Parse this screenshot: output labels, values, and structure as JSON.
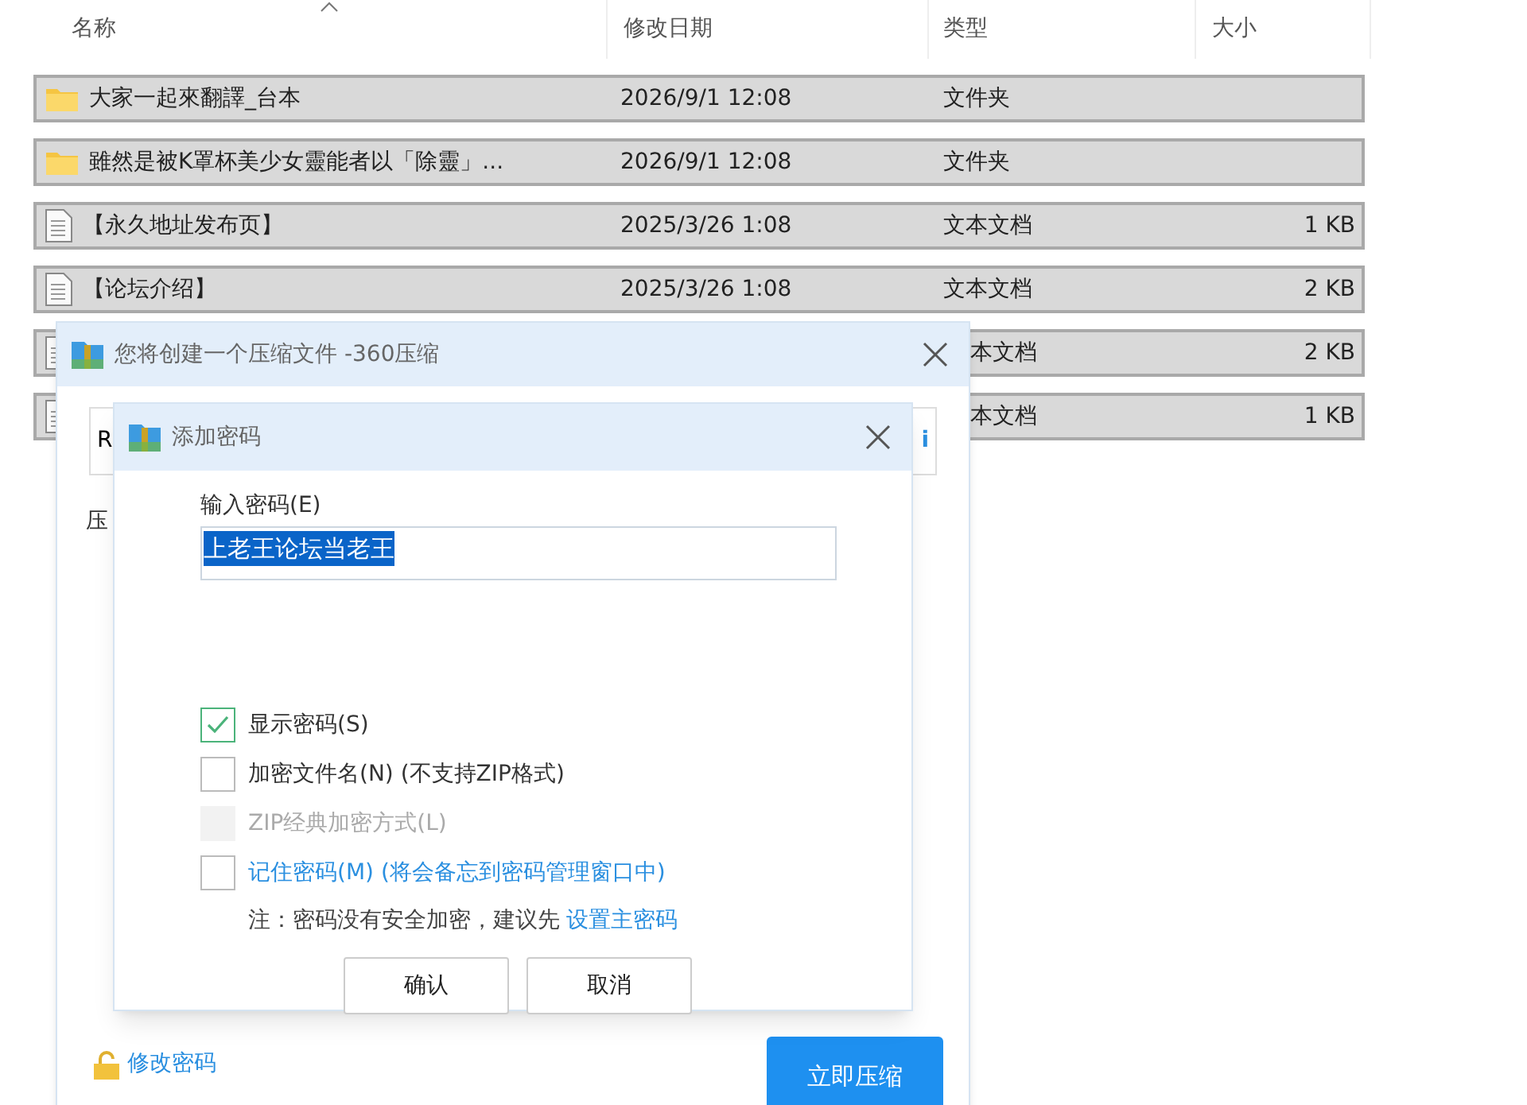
{
  "explorer": {
    "columns": [
      "名称",
      "修改日期",
      "类型",
      "大小"
    ],
    "rows": [
      {
        "kind": "folder",
        "name": "大家一起來翻譯_台本",
        "date": "2026/9/1 12:08",
        "type": "文件夹",
        "selected": true
      },
      {
        "kind": "folder",
        "name": "雖然是被K罩杯美少女靈能者以「除靈」...",
        "date": "2026/9/1 12:08",
        "type": "文件夹",
        "selected": true
      },
      {
        "kind": "text",
        "name": "【永久地址发布页】",
        "date": "2025/3/26 1:08",
        "type": "文本文档",
        "size": "1 KB",
        "selected": true
      },
      {
        "kind": "text",
        "name": "【论坛介绍】",
        "date": "2025/3/26 1:08",
        "type": "文本文档",
        "size": "2 KB",
        "selected": true
      },
      {
        "kind": "text",
        "type": "本文档",
        "size": "2 KB",
        "selected": true
      },
      {
        "kind": "text",
        "type": "本文档",
        "size": "1 KB",
        "selected": true
      }
    ]
  },
  "compress_dialog": {
    "title": "您将创建一个压缩文件 -360压缩",
    "path_field": {
      "value": "R",
      "button": "i"
    },
    "label": "压",
    "change_password": "修改密码",
    "compress_button": "立即压缩"
  },
  "password_dialog": {
    "title": "添加密码",
    "password_label": "输入密码(E)",
    "password": "上老王论坛当老王",
    "options": [
      {
        "label": "显示密码(S)",
        "checked": true,
        "disabled": false,
        "kind": "plain"
      },
      {
        "label": "加密文件名(N) (不支持ZIP格式)",
        "checked": false,
        "disabled": false,
        "kind": "plain"
      },
      {
        "label": "ZIP经典加密方式(L)",
        "checked": false,
        "disabled": true,
        "kind": "plain"
      },
      {
        "label": "记住密码(M) (将会备忘到密码管理窗口中)",
        "checked": false,
        "disabled": false,
        "kind": "link"
      }
    ],
    "note": "注：密码没有安全加密，建议先",
    "note_link": "设置主密码",
    "buttons": [
      "确认",
      "取消"
    ]
  }
}
